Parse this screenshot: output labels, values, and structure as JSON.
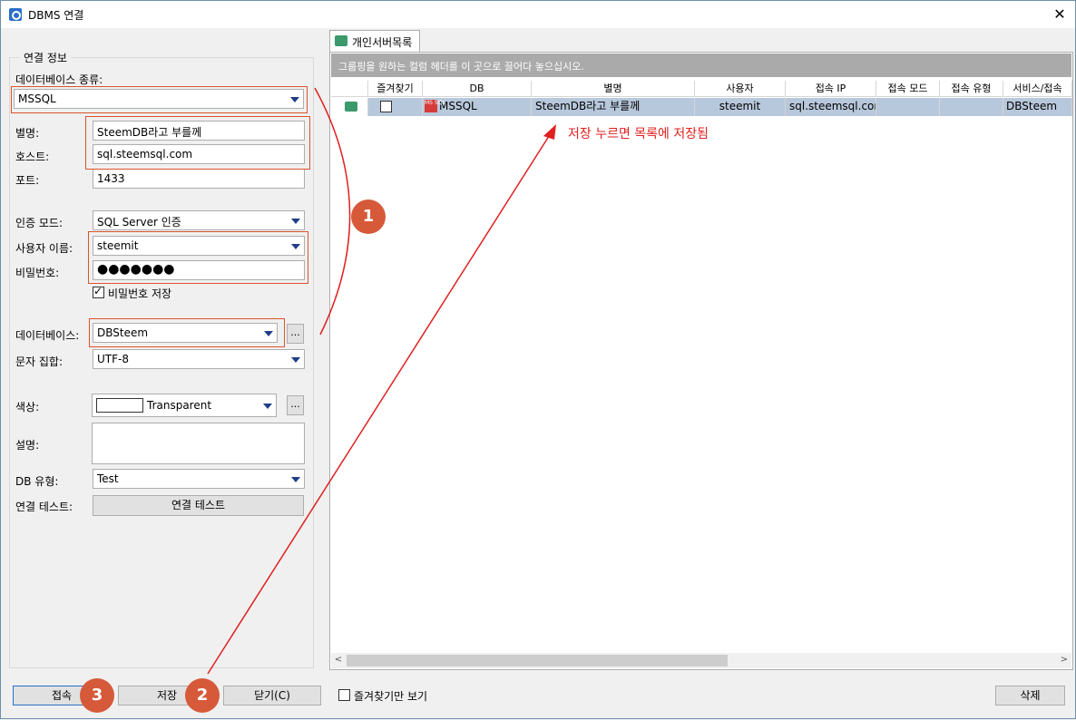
{
  "window": {
    "title": "DBMS 연결",
    "close_glyph": "✕"
  },
  "left": {
    "group_title": "연결 정보",
    "db_type_label": "데이터베이스 종류:",
    "db_type_value": "MSSQL",
    "alias_label": "별명:",
    "alias_value": "SteemDB라고 부를께",
    "host_label": "호스트:",
    "host_value": "sql.steemsql.com",
    "port_label": "포트:",
    "port_value": "1433",
    "auth_label": "인증 모드:",
    "auth_value": "SQL Server 인증",
    "user_label": "사용자 이름:",
    "user_value": "steemit",
    "pw_label": "비밀번호:",
    "pw_value": "●●●●●●●",
    "save_pw_label": "비밀번호 저장",
    "save_pw_checked": true,
    "database_label": "데이터베이스:",
    "database_value": "DBSteem",
    "charset_label": "문자 집합:",
    "charset_value": "UTF-8",
    "color_label": "색상:",
    "color_value": "Transparent",
    "desc_label": "설명:",
    "desc_value": "",
    "dbtype_label": "DB 유형:",
    "dbtype_value": "Test",
    "conntest_label": "연결 테스트:",
    "conntest_button": "연결 테스트",
    "ellipsis": "..."
  },
  "right": {
    "tab_label": "개인서버목록",
    "group_hint": "그룹핑을 원하는 컬럼 헤더를 이 곳으로 끌어다 놓으십시오.",
    "columns": [
      "즐겨찾기",
      "DB",
      "별명",
      "사용자",
      "접속 IP",
      "접속 모드",
      "접속 유형",
      "서비스/접속"
    ],
    "row": {
      "db": "MSSQL",
      "db_icon_text": "MS SQL",
      "alias": "SteemDB라고 부를께",
      "user": "steemit",
      "ip": "sql.steemsql.com",
      "mode": "",
      "type": "",
      "service": "DBSteem"
    },
    "scroll_left": "<",
    "scroll_right": ">"
  },
  "annotation": {
    "note": "저장 누르면 목록에 저장됨",
    "badges": [
      "1",
      "2",
      "3"
    ],
    "color": "#d65a3a",
    "line_color": "#e02020"
  },
  "bottom": {
    "connect_button": "접속",
    "save_button": "저장",
    "close_button": "닫기(C)",
    "favorites_only_label": "즐겨찾기만 보기",
    "delete_button": "삭제"
  }
}
